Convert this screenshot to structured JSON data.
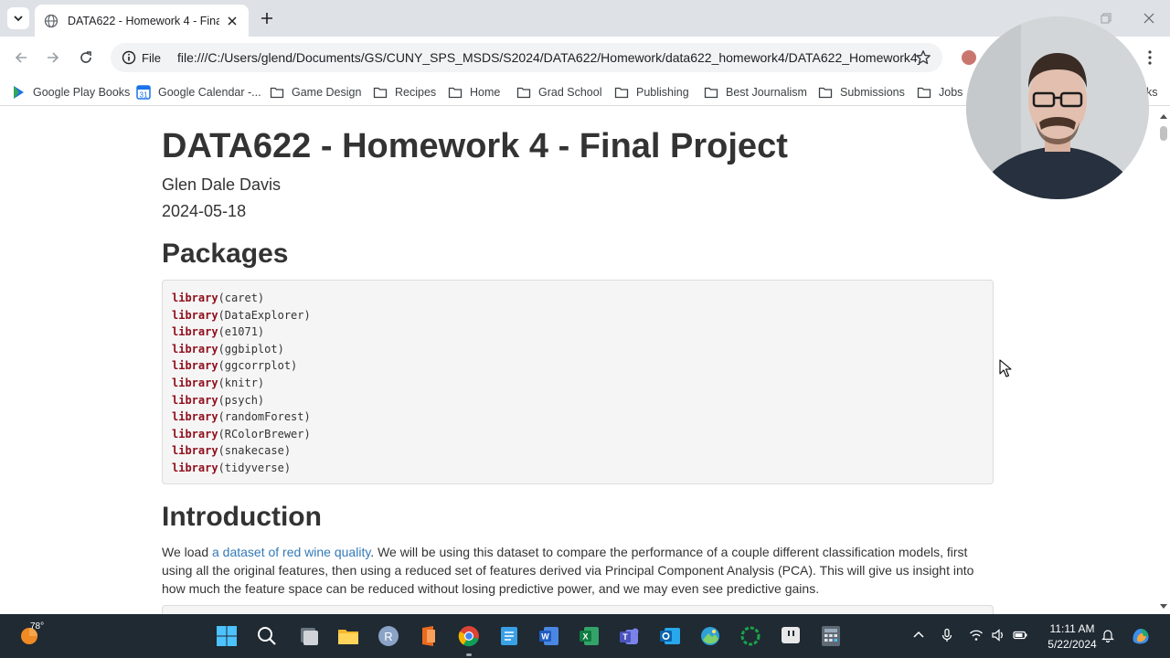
{
  "browser": {
    "tab": {
      "title": "DATA622 - Homework 4 - Final Project"
    },
    "address": {
      "chip_label": "File",
      "url": "file:///C:/Users/glend/Documents/GS/CUNY_SPS_MSDS/S2024/DATA622/Homework/data622_homework4/DATA622_Homework4_..."
    },
    "bookmarks": [
      {
        "label": "Google Play Books",
        "icon": "play-books-icon"
      },
      {
        "label": "Google Calendar -...",
        "icon": "calendar-icon"
      },
      {
        "label": "Game Design",
        "icon": "folder-icon"
      },
      {
        "label": "Recipes",
        "icon": "folder-icon"
      },
      {
        "label": "Home",
        "icon": "folder-icon"
      },
      {
        "label": "Grad School",
        "icon": "folder-icon"
      },
      {
        "label": "Publishing",
        "icon": "folder-icon"
      },
      {
        "label": "Best Journalism",
        "icon": "folder-icon"
      },
      {
        "label": "Submissions",
        "icon": "folder-icon"
      },
      {
        "label": "Jobs",
        "icon": "folder-icon"
      },
      {
        "label": "ks",
        "icon": ""
      }
    ]
  },
  "doc": {
    "title": "DATA622 - Homework 4 - Final Project",
    "author": "Glen Dale Davis",
    "date": "2024-05-18",
    "packages_heading": "Packages",
    "code_lines": [
      {
        "fn": "library",
        "arg": "(caret)"
      },
      {
        "fn": "library",
        "arg": "(DataExplorer)"
      },
      {
        "fn": "library",
        "arg": "(e1071)"
      },
      {
        "fn": "library",
        "arg": "(ggbiplot)"
      },
      {
        "fn": "library",
        "arg": "(ggcorrplot)"
      },
      {
        "fn": "library",
        "arg": "(knitr)"
      },
      {
        "fn": "library",
        "arg": "(psych)"
      },
      {
        "fn": "library",
        "arg": "(randomForest)"
      },
      {
        "fn": "library",
        "arg": "(RColorBrewer)"
      },
      {
        "fn": "library",
        "arg": "(snakecase)"
      },
      {
        "fn": "library",
        "arg": "(tidyverse)"
      }
    ],
    "intro_heading": "Introduction",
    "intro": {
      "prefix": "We load ",
      "link": "a dataset of red wine quality",
      "suffix": ". We will be using this dataset to compare the performance of a couple different classification models, first using all the original features, then using a reduced set of features derived via Principal Component Analysis (PCA). This will give us insight into how much the feature space can be reduced without losing predictive power, and we may even see predictive gains."
    }
  },
  "taskbar": {
    "weather_temp": "78°",
    "apps": [
      "start-icon",
      "search-icon",
      "task-view-icon",
      "file-explorer-icon",
      "r-icon",
      "office-icon",
      "chrome-icon",
      "notepad-icon",
      "word-icon",
      "excel-icon",
      "teams-icon",
      "outlook-icon",
      "photos-icon",
      "loader-icon",
      "twitch-icon",
      "calculator-icon"
    ],
    "clock_time": "11:11 AM",
    "clock_date": "5/22/2024"
  },
  "colors": {
    "tab_strip": "#dee1e6",
    "link": "#337ab7",
    "keyword": "#8f0d1a",
    "taskbar": "#1f2a33"
  }
}
